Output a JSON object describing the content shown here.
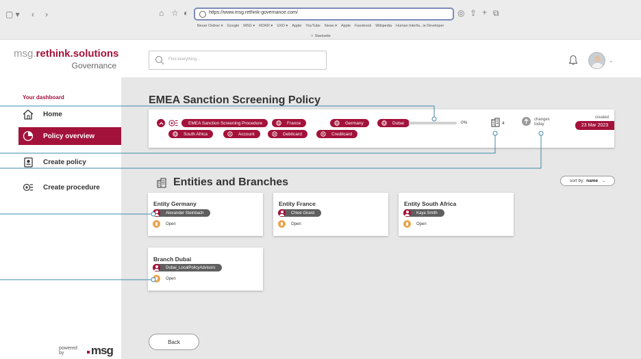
{
  "browser": {
    "url": "https://www.msg.rethink-governance.com/",
    "bookmarks": [
      "Neuer Ordner ▾",
      "Google",
      "MSG ▾",
      "ROKR ▾",
      "UXD ▾",
      "Apple",
      "YouTube",
      "News ▾",
      "Apple",
      "Facebook",
      "Wikipedia",
      "Human Interfa...ie Developer"
    ],
    "start_page": "☆ Startseite"
  },
  "brand": {
    "name_prefix": "msg.",
    "name_bold": "rethink.solutions",
    "subtitle": "Governance",
    "powered_by": "powered by",
    "vendor": "msg",
    "accent_color": "#a3123a"
  },
  "sidebar": {
    "section_title": "Your dashboard",
    "items": [
      {
        "label": "Home",
        "icon": "home-icon",
        "active": false
      },
      {
        "label": "Policy overview",
        "icon": "pie-chart-icon",
        "active": true
      },
      {
        "label": "Create policy",
        "icon": "document-icon",
        "active": false
      },
      {
        "label": "Create procedure",
        "icon": "procedure-icon",
        "active": false
      }
    ]
  },
  "header": {
    "search_placeholder": "Find everything..."
  },
  "policy": {
    "title": "EMEA Sanction Screening Policy",
    "procedure": "EMEA Sanction Screening Procedure",
    "regions": [
      "France",
      "Germany",
      "Dubai",
      "South Africa"
    ],
    "accounts": [
      "Account",
      "Debitcard",
      "Creditcard"
    ],
    "progress_percent": 3,
    "progress_label": "0%",
    "entity_count": "4",
    "changes_line1": "changes",
    "changes_line2": "today",
    "created_label": "created",
    "created_date": "23 Mar 2023"
  },
  "entities": {
    "title": "Entities and Branches",
    "sort_label": "sort by:",
    "sort_value": "name",
    "cards": [
      {
        "name": "Entity Germany",
        "person": "Alexander Steinbach",
        "status": "Open"
      },
      {
        "name": "Entity France",
        "person": "Chloé Girard",
        "status": "Open"
      },
      {
        "name": "Entity South Africa",
        "person": "Kaya Smith",
        "status": "Open"
      },
      {
        "name": "Branch Dubai",
        "person": "Dubai_LocalPolicyAdvisors",
        "status": "Open"
      }
    ]
  },
  "actions": {
    "back_label": "Back"
  }
}
